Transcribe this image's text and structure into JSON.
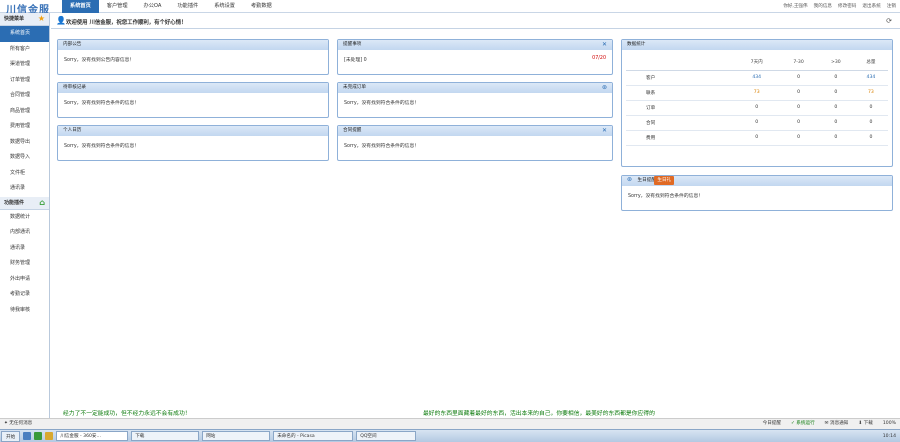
{
  "app": {
    "logo": "川信金服"
  },
  "nav": {
    "items": [
      "系统首页",
      "客户管理",
      "办公OA",
      "功能插件",
      "系统设置",
      "考勤数据"
    ]
  },
  "top_links": [
    "你好,王强伟",
    "我的信息",
    "修改密码",
    "退出系统",
    "注销"
  ],
  "sidebar": {
    "header1": "快捷菜单",
    "items1": [
      "系统首页",
      "所有客户",
      "渠道管理",
      "订单管理",
      "合同管理",
      "商品管理",
      "费用管理",
      "数据导出",
      "数据导入",
      "文件柜",
      "通讯录"
    ],
    "header2": "功能插件",
    "items2": [
      "数据统计",
      "内部通讯",
      "通讯录",
      "财务管理",
      "外出申请",
      "考勤记录",
      "待我审核"
    ]
  },
  "welcome": {
    "text": "欢迎使用 川信金服，祝您工作顺利，有个好心情！"
  },
  "panels": {
    "notice": {
      "title": "内部公告",
      "body": "Sorry，没有找到公告内容信息！"
    },
    "reminder": {
      "title": "提醒事项",
      "body": "[未处理] 0",
      "count": "07/20"
    },
    "review": {
      "title": "待审核记录",
      "body": "Sorry，没有找到符合条件的信息！"
    },
    "unpaid": {
      "title": "未完成订单",
      "body": "Sorry，没有找到符合条件的信息！"
    },
    "schedule": {
      "title": "个人日历",
      "body": "Sorry，没有找到符合条件的信息！"
    },
    "contract": {
      "title": "合同提醒",
      "body": "Sorry，没有找到符合条件的信息！"
    },
    "stats": {
      "title": "数据统计"
    },
    "birthday": {
      "title": "生日提醒",
      "badge": "生日礼",
      "body": "Sorry，没有找到符合条件的信息！"
    }
  },
  "stats": {
    "columns": [
      "",
      "7天内",
      "7-30",
      ">30",
      "总量"
    ],
    "rows": [
      {
        "label": "客户",
        "values": [
          "434",
          "0",
          "0",
          "434"
        ]
      },
      {
        "label": "联系",
        "values": [
          "73",
          "0",
          "0",
          "73"
        ]
      },
      {
        "label": "订单",
        "values": [
          "0",
          "0",
          "0",
          "0"
        ]
      },
      {
        "label": "合同",
        "values": [
          "0",
          "0",
          "0",
          "0"
        ]
      },
      {
        "label": "费用",
        "values": [
          "0",
          "0",
          "0",
          "0"
        ]
      }
    ]
  },
  "marquee": {
    "m1": "经力了不一定能成功，但不经力永远不会有成功！",
    "m2": "最好的东西里面藏着最好的东西，活出本来的自己，你要相信，最美好的东西都是你应得的"
  },
  "statusbar": {
    "left": "✦ 无任何消息",
    "right": [
      "今日提醒",
      "✓ 系统运行",
      "✉ 消息通知",
      "⬇ 下载",
      "100%"
    ]
  },
  "taskbar": {
    "start": "开始",
    "items": [
      "川信金服 - 360安...",
      "下载",
      "网站",
      "未命名的 - Picasa",
      "QQ空间"
    ],
    "clock": "10:14"
  }
}
